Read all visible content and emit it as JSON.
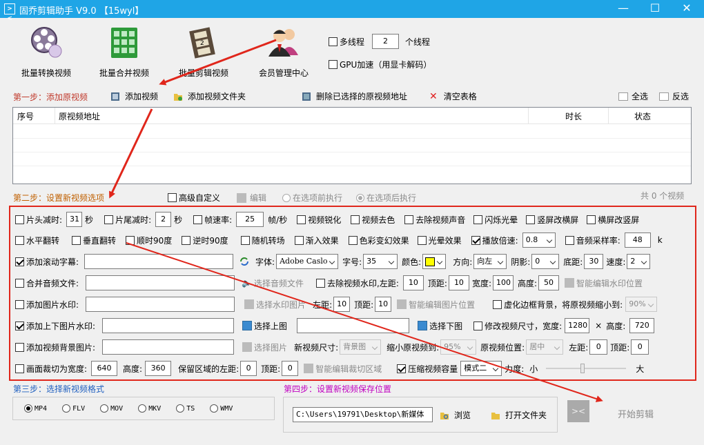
{
  "window": {
    "title": "固乔剪辑助手 V9.0  【15wyl】",
    "icon_label": "><",
    "buttons": [
      "minimize-icon",
      "maximize-icon",
      "close-icon"
    ]
  },
  "toolbar": {
    "batch_convert": "批量转换视频",
    "batch_merge": "批量合并视频",
    "batch_edit": "批量剪辑视频",
    "member_center": "会员管理中心",
    "multithread_label": "多线程",
    "thread_count": "2",
    "thread_unit": "个线程",
    "gpu_label": "GPU加速（用显卡解码）"
  },
  "step1": {
    "title": "第一步：添加原视频",
    "add_video": "添加视频",
    "add_folder": "添加视频文件夹",
    "delete_selected": "删除已选择的原视频地址",
    "clear_table": "清空表格",
    "select_all": "全选",
    "invert": "反选"
  },
  "table": {
    "columns": [
      "序号",
      "原视频地址",
      "时长",
      "状态"
    ],
    "rows": []
  },
  "step2": {
    "title": "第二步：设置新视频选项",
    "advanced": "高级自定义",
    "edit": "编辑",
    "before": "在选项前执行",
    "after": "在选项后执行",
    "count": "共 0 个视频"
  },
  "options": {
    "row1": {
      "head_cut": "片头减时:",
      "head_val": "31",
      "sec1": "秒",
      "tail_cut": "片尾减时:",
      "tail_val": "2",
      "sec2": "秒",
      "framerate": "帧速率:",
      "framerate_val": "25",
      "fps_unit": "帧/秒",
      "sharpen": "视频锐化",
      "decolor": "视频去色",
      "remove_audio": "去除视频声音",
      "flash": "闪烁光晕",
      "v2h": "竖屏改横屏",
      "h2v": "横屏改竖屏"
    },
    "row2": {
      "hflip": "水平翻转",
      "vflip": "垂直翻转",
      "rot90cw": "顺时90度",
      "rot90ccw": "逆时90度",
      "random_transition": "随机转场",
      "fade_in": "渐入效果",
      "color_change": "色彩变幻效果",
      "halo": "光晕效果",
      "speed_label": "播放倍速:",
      "speed_val": "0.8",
      "samplerate_label": "音频采样率:",
      "samplerate_val": "48",
      "samplerate_unit": "k"
    },
    "row3": {
      "scroll_text": "添加滚动字幕:",
      "scroll_val": "",
      "font_label": "字体:",
      "font_val": "Adobe Caslo",
      "size_label": "字号:",
      "size_val": "35",
      "color_label": "颜色:",
      "color": "#ffff00",
      "direction_label": "方向:",
      "direction_val": "向左",
      "shadow_label": "阴影:",
      "shadow_val": "0",
      "bottom_label": "底距:",
      "bottom_val": "30",
      "speed_label": "速度:",
      "speed_val": "2"
    },
    "row4": {
      "merge_audio": "合并音频文件:",
      "merge_val": "",
      "pick_audio": "选择音频文件",
      "remove_watermark": "去除视频水印,",
      "left_label": "左距:",
      "left_val": "10",
      "top_label": "顶距:",
      "top_val": "10",
      "width_label": "宽度:",
      "width_val": "100",
      "height_label": "高度:",
      "height_val": "50",
      "smart_watermark": "智能编辑水印位置"
    },
    "row5": {
      "image_watermark": "添加图片水印:",
      "image_val": "",
      "pick_watermark": "选择水印图片",
      "left_label": "左距:",
      "left_val": "10",
      "top_label": "顶距:",
      "top_val": "10",
      "smart_image": "智能编辑图片位置",
      "blur_bg": "虚化边框背景，将原视频缩小到:",
      "blur_val": "90%"
    },
    "row6": {
      "tb_watermark": "添加上下图片水印:",
      "top_img_val": "",
      "pick_top": "选择上图",
      "bottom_img_val": "",
      "pick_bottom": "选择下图",
      "resize": "修改视频尺寸，宽度:",
      "width_val": "1280",
      "times": "×",
      "height_label": "高度:",
      "height_val": "720"
    },
    "row7": {
      "bg_image": "添加视频背景图片:",
      "bg_val": "",
      "pick_image": "选择图片",
      "new_size_label": "新视频尺寸:",
      "new_size_val": "背景图",
      "shrink_label": "缩小原视频到:",
      "shrink_val": "95%",
      "position_label": "原视频位置:",
      "position_val": "居中",
      "left_label": "左距:",
      "left_val": "0",
      "top_label": "顶距:",
      "top_val": "0"
    },
    "row8": {
      "crop": "画面裁切为宽度:",
      "crop_w": "640",
      "height_label": "高度:",
      "crop_h": "360",
      "keep_left_label": "保留区域的左距:",
      "keep_left": "0",
      "top_label": "顶距:",
      "keep_top": "0",
      "smart_crop": "智能编辑裁切区域",
      "compress": "压缩视频容量",
      "compress_mode": "模式二",
      "strength_label": "力度:",
      "small": "小",
      "big": "大",
      "strength": 0.45
    }
  },
  "step3": {
    "title": "第三步：选择新视频格式",
    "formats": [
      "MP4",
      "FLV",
      "MOV",
      "MKV",
      "TS",
      "WMV"
    ],
    "selected": "MP4"
  },
  "step4": {
    "title": "第四步：设置新视频保存位置",
    "path": "C:\\Users\\19791\\Desktop\\新媒体",
    "browse": "浏览",
    "open_folder": "打开文件夹",
    "start": "开始剪辑"
  },
  "colors": {
    "titlebar": "#1fa5e6",
    "step_red": "#c0392b",
    "step_orange": "#c06000",
    "step3_blue": "#1f5fbf",
    "step4_purple": "#c000c0",
    "highlight_red": "#e0261b"
  }
}
